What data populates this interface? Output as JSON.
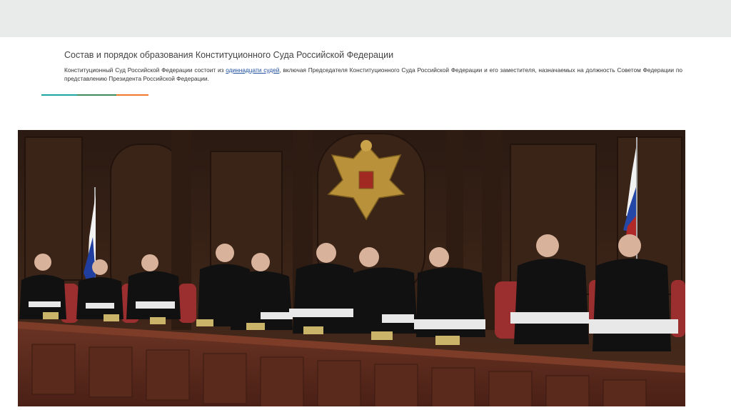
{
  "slide": {
    "title": "Состав и порядок образования Конституционного Суда Российской Федерации",
    "body_before": "Конституционный Суд Российской Федерации состоит из ",
    "body_link": "одиннадцати судей",
    "body_after": ", включая Председателя Конституционного Суда Российской Федерации и его заместителя, назначаемых на должность Советом Федерации по представлению Президента Российской Федерации."
  },
  "colors": {
    "band": "#e9ebea",
    "rule": [
      "#1aa6a0",
      "#3b8c5a",
      "#f07a2a"
    ]
  },
  "photo": {
    "subject": "eleven judges in black robes standing behind a wooden bench, coat of arms and two Russian flags"
  }
}
